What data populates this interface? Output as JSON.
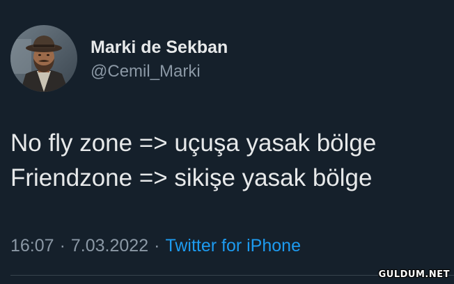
{
  "author": {
    "display_name": "Marki de Sekban",
    "handle": "@Cemil_Marki"
  },
  "tweet": {
    "lines": [
      "No fly zone => uçuşa yasak bölge",
      "Friendzone => sikişe yasak bölge"
    ]
  },
  "meta": {
    "time": "16:07",
    "separator": "·",
    "date": "7.03.2022",
    "source": "Twitter for iPhone"
  },
  "watermark": "GULDUM.NET",
  "colors": {
    "background": "#15202b",
    "primary_text": "#e7e9ea",
    "secondary_text": "#8b98a5",
    "link": "#1d9bf0"
  }
}
